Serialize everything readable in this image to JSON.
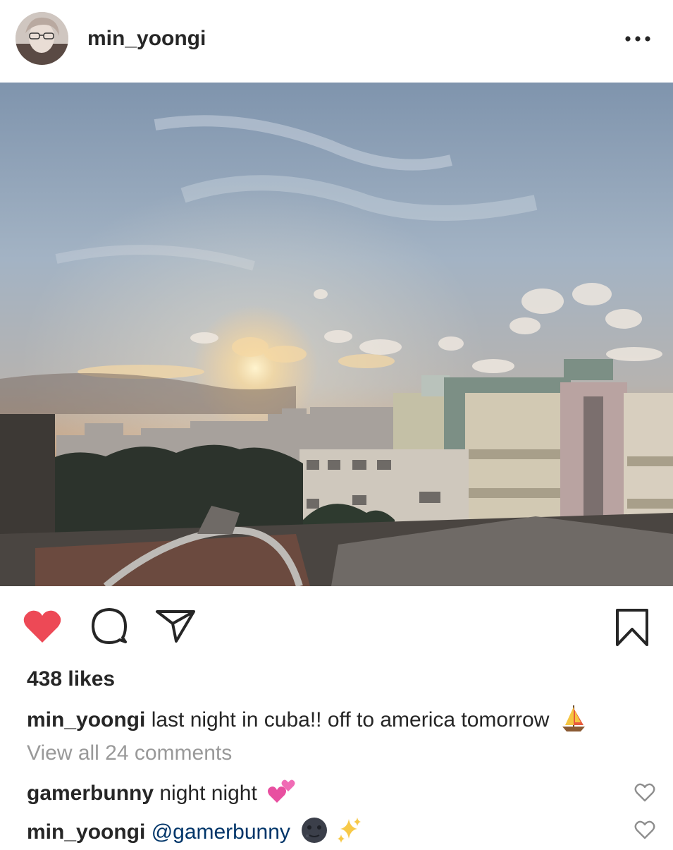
{
  "post": {
    "username": "min_yoongi",
    "likes": "438 likes",
    "caption_user": "min_yoongi",
    "caption_text": "last night in cuba!! off to america tomorrow",
    "caption_emoji": "sailboat",
    "view_all": "View all 24 comments",
    "liked": true
  },
  "comments": [
    {
      "user": "gamerbunny",
      "text": "night night",
      "emoji": "two-hearts"
    },
    {
      "user": "min_yoongi",
      "mention": "@gamerbunny",
      "emoji": "new-moon-face sparkles"
    }
  ],
  "colors": {
    "heart": "#ed4956",
    "mention": "#003569",
    "muted": "#999999",
    "text": "#262626"
  },
  "icons": [
    "avatar",
    "more-icon",
    "heart-icon",
    "comment-icon",
    "share-icon",
    "bookmark-icon",
    "comment-like-icon"
  ]
}
